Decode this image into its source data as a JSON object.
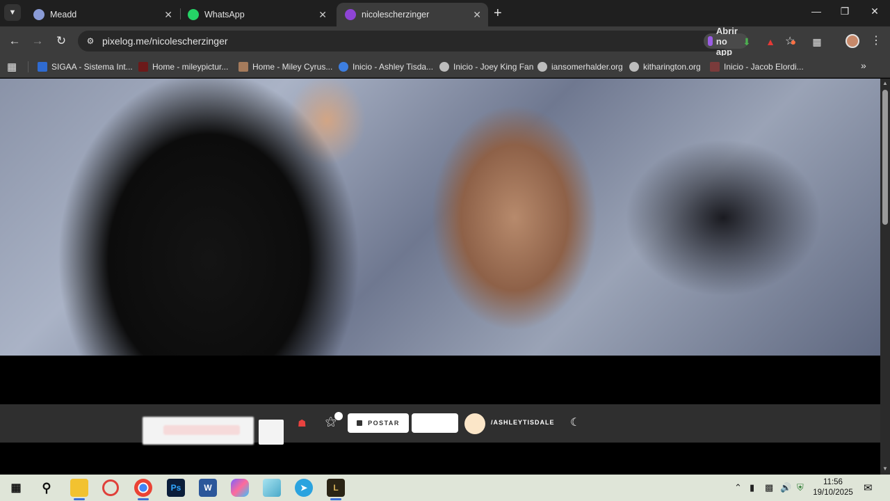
{
  "browser": {
    "tabs": [
      {
        "title": "Meadd",
        "active": false
      },
      {
        "title": "WhatsApp",
        "active": false
      },
      {
        "title": "nicolescherzinger",
        "active": true
      }
    ],
    "url": "pixelog.me/nicolescherzinger",
    "open_app_label": "Abrir no app"
  },
  "bookmarks": [
    {
      "label": "SIGAA - Sistema Int..."
    },
    {
      "label": "Home - mileypictur..."
    },
    {
      "label": "Home - Miley Cyrus..."
    },
    {
      "label": "Inicio - Ashley Tisda..."
    },
    {
      "label": "Inicio - Joey King Fan"
    },
    {
      "label": "iansomerhalder.org"
    },
    {
      "label": "kitharington.org"
    },
    {
      "label": "Inicio - Jacob Elordi..."
    }
  ],
  "site_header": {
    "post_label": "POSTAR",
    "username": "/ASHLEYTISDALE"
  },
  "taskbar": {
    "time": "11:56",
    "date": "19/10/2025"
  }
}
